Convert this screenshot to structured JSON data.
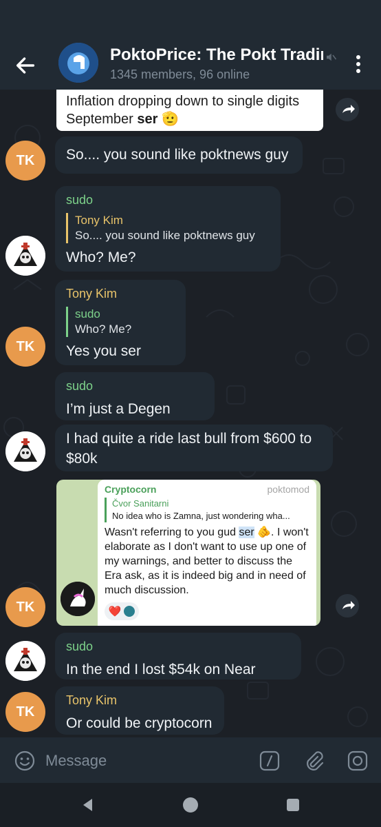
{
  "header": {
    "title": "PoktoPrice: The Pokt Tradin",
    "subtitle": "1345 members, 96 online"
  },
  "quote_card": {
    "line1": "Inflation dropping down to single digits",
    "line2_prefix": "September ",
    "line2_bold": "ser",
    "emoji": "🫡"
  },
  "messages": {
    "m1": {
      "text": "So.... you sound like poktnews guy",
      "avatar": "TK"
    },
    "m2": {
      "sender": "sudo",
      "reply_name": "Tony Kim",
      "reply_text": "So.... you sound like poktnews guy",
      "text": "Who? Me?"
    },
    "m3": {
      "sender": "Tony Kim",
      "reply_name": "sudo",
      "reply_text": "Who? Me?",
      "text": "Yes you ser",
      "avatar": "TK"
    },
    "m4": {
      "sender": "sudo",
      "text": "I’m just a Degen"
    },
    "m5": {
      "line1": "I had quite a ride last bull from $600 to",
      "line2": "$80k"
    },
    "m6": {
      "avatar": "TK"
    },
    "m7": {
      "sender": "sudo",
      "text": "In the end I lost $54k on Near"
    },
    "m8": {
      "sender": "Tony Kim",
      "text": "Or could be cryptocorn",
      "avatar": "TK"
    }
  },
  "shot": {
    "name": "Cryptocorn",
    "tag": "poktomod",
    "reply_name": "Čvor Sanitarni",
    "reply_text": "No idea who is Zamna, just wondering wha...",
    "body_pre": "Wasn't referring to you gud ",
    "body_hl": "ser",
    "body_post": " 🫵. I won't elaborate as I don't want to use up one of my warnings, and better to discuss the Era ask, as it is indeed big and in need of much discussion.",
    "reaction1": "❤️"
  },
  "input": {
    "placeholder": "Message"
  },
  "colors": {
    "bubble": "#212a33",
    "background": "#1c2026",
    "sender_green": "#7dd28a",
    "sender_gold": "#e9c46a",
    "avatar_orange": "#e89a4c"
  }
}
